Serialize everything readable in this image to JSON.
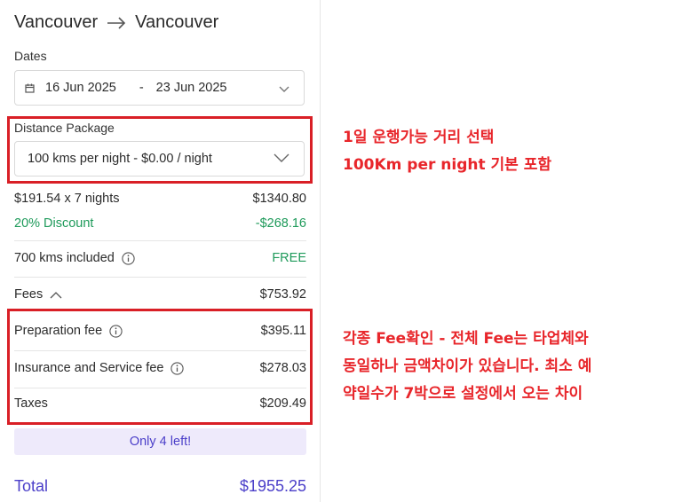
{
  "route": {
    "from": "Vancouver",
    "to": "Vancouver"
  },
  "dates": {
    "label": "Dates",
    "start": "16 Jun 2025",
    "separator": "-",
    "end": "23 Jun 2025"
  },
  "distance_package": {
    "label": "Distance Package",
    "selected": "100 kms per night - $0.00 / night"
  },
  "pricing": {
    "nightly_label": "$191.54 x 7 nights",
    "nightly_amount": "$1340.80",
    "discount_label": "20% Discount",
    "discount_amount": "-$268.16",
    "kms_label": "700 kms included",
    "kms_value": "FREE",
    "fees_label": "Fees",
    "fees_amount": "$753.92",
    "preparation_label": "Preparation fee",
    "preparation_amount": "$395.11",
    "insurance_label": "Insurance and Service fee",
    "insurance_amount": "$278.03",
    "taxes_label": "Taxes",
    "taxes_amount": "$209.49"
  },
  "banner": "Only 4 left!",
  "total": {
    "label": "Total",
    "amount": "$1955.25"
  },
  "annotations": {
    "note1_line1": "1일 운행가능 거리 선택",
    "note1_line2": "100Km per night 기본 포함",
    "note2_line1": "각종 Fee확인 - 전체 Fee는 타업체와",
    "note2_line2": "동일하나 금액차이가 있습니다. 최소 예",
    "note2_line3": "약일수가 7박으로 설정에서 오는 차이"
  },
  "colors": {
    "accent": "#4b3fc9",
    "discount_green": "#1e9a5a",
    "annotation_red": "#e8262b",
    "banner_bg": "#eeeafb"
  },
  "icons": [
    "arrow-right-icon",
    "calendar-icon",
    "chevron-down-icon",
    "info-icon",
    "chevron-up-icon"
  ]
}
